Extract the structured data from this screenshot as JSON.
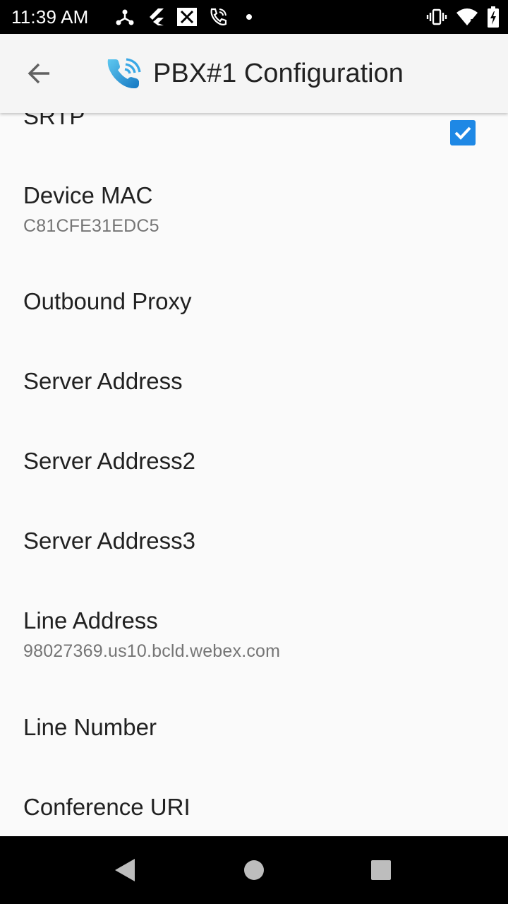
{
  "status_bar": {
    "time": "11:39 AM",
    "left_icons": [
      "hub-icon",
      "flutter-icon",
      "close-box-icon",
      "phone-wifi-icon",
      "dot-icon"
    ],
    "right_icons": [
      "vibrate-icon",
      "wifi-icon",
      "battery-charging-icon"
    ]
  },
  "toolbar": {
    "title": "PBX#1 Configuration",
    "back_icon": "arrow-back-icon",
    "app_icon": "phone-wifi-icon"
  },
  "preferences": [
    {
      "title": "SRTP",
      "summary": "",
      "checked": true
    },
    {
      "title": "Device MAC",
      "summary": "C81CFE31EDC5"
    },
    {
      "title": "Outbound Proxy",
      "summary": ""
    },
    {
      "title": "Server Address",
      "summary": ""
    },
    {
      "title": "Server Address2",
      "summary": ""
    },
    {
      "title": "Server Address3",
      "summary": ""
    },
    {
      "title": "Line Address",
      "summary": "98027369.us10.bcld.webex.com"
    },
    {
      "title": "Line Number",
      "summary": ""
    },
    {
      "title": "Conference URI",
      "summary": ""
    }
  ],
  "colors": {
    "accent": "#1e88e5",
    "toolbar_bg": "#f5f5f5",
    "page_bg": "#fafafa"
  },
  "nav_bar": {
    "icons": [
      "back-triangle-icon",
      "home-circle-icon",
      "recents-square-icon"
    ]
  }
}
